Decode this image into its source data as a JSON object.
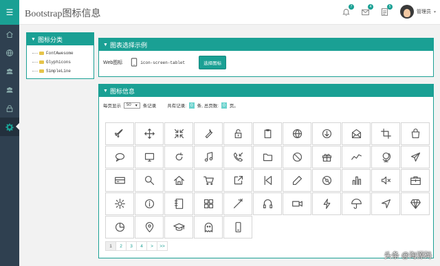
{
  "header": {
    "title": "Bootstrap图标信息",
    "badges": [
      "7",
      "4",
      "5"
    ],
    "user": "管理员"
  },
  "sidebar": {
    "icons": [
      "menu-icon",
      "home-icon",
      "globe-icon",
      "users-icon",
      "users-icon",
      "lock-icon",
      "gear-icon"
    ]
  },
  "category": {
    "title": "图标分类",
    "items": [
      "FontAwesome",
      "Glyphicons",
      "SimpleLine"
    ]
  },
  "example": {
    "title": "图表选择示例",
    "label": "Web图标",
    "icon_code": "icon-screen-tablet",
    "button": "选择图标"
  },
  "info": {
    "title": "图标信息",
    "per_page_label": "每页显示",
    "per_page_value": "50",
    "per_page_suffix": "条记录",
    "total_prefix": "共有记录:",
    "total": "0",
    "total_mid": "条, 总页数:",
    "pages": "0",
    "pages_suffix": "页。"
  },
  "icons": [
    "plane",
    "move",
    "minimize",
    "wrench",
    "lock-open",
    "clipboard",
    "globe",
    "arrow-down-circle",
    "mail-open",
    "crop",
    "bag",
    "speech",
    "screen",
    "refresh",
    "music",
    "call-in",
    "folder",
    "ban",
    "gift",
    "graph",
    "globe-alt",
    "paper-plane",
    "credit-card",
    "magnifier",
    "home",
    "basket",
    "share-alt",
    "control-start",
    "pencil",
    "disc",
    "bar-chart",
    "volume-off",
    "briefcase",
    "settings",
    "info",
    "notebook",
    "grid",
    "magic-wand",
    "earphones",
    "camrecorder",
    "energy",
    "umbrella",
    "direction",
    "diamond",
    "pie-chart",
    "location-pin",
    "graduation",
    "ghost",
    "phone"
  ],
  "pager": [
    "1",
    "2",
    "3",
    "4",
    ">",
    ">>"
  ],
  "watermark": "头条 @淘源码"
}
